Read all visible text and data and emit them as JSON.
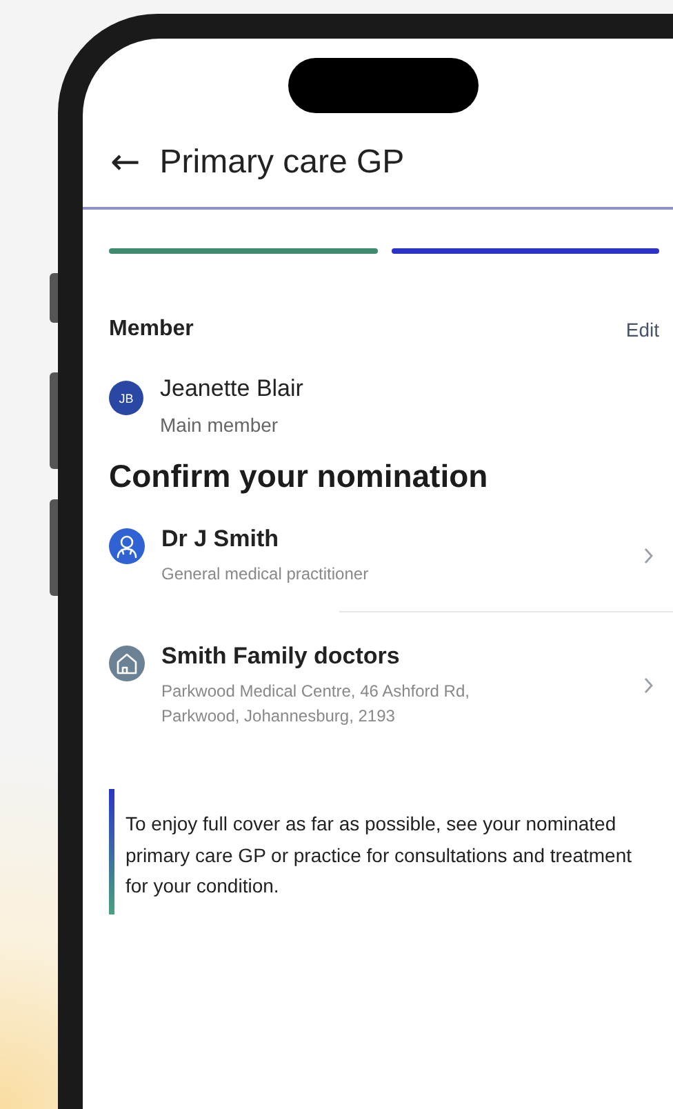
{
  "header": {
    "back_icon": "←",
    "title": "Primary care GP"
  },
  "steps": [
    {
      "selected": false
    },
    {
      "selected": true
    }
  ],
  "member": {
    "heading": "Member",
    "edit": "Edit",
    "initials": "JB",
    "name": "Jeanette Blair",
    "role": "Main member"
  },
  "nomination": {
    "heading": "Confirm your nomination",
    "items": [
      {
        "kind": "doctor",
        "title": "Dr J Smith",
        "subtitle": "General medical practitioner"
      },
      {
        "kind": "practice",
        "title": "Smith Family doctors",
        "subtitle": "Parkwood Medical Centre, 46 Ashford Rd, Parkwood, Johannesburg, 2193"
      }
    ]
  },
  "notice": "To enjoy full cover as far as possible, see your nominated primary care GP or practice for consultations and treatment for your condition."
}
